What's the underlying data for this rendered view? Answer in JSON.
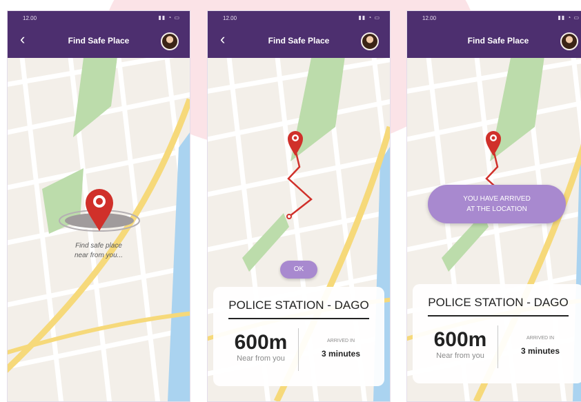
{
  "screens": [
    {
      "status_time": "12.00",
      "title": "Find Safe Place",
      "back_label": "‹",
      "hint_line1": "Find safe place",
      "hint_line2": "near from you..."
    },
    {
      "status_time": "12.00",
      "title": "Find Safe Place",
      "back_label": "‹",
      "ok_label": "OK",
      "place_name": "POLICE STATION - DAGO",
      "distance": "600m",
      "distance_sub": "Near from you",
      "arrive_label": "ARRIVED IN",
      "arrive_value": "3 minutes"
    },
    {
      "status_time": "12.00",
      "title": "Find Safe Place",
      "banner_line1": "YOU HAVE ARRIVED",
      "banner_line2": "AT THE LOCATION",
      "place_name": "POLICE STATION - DAGO",
      "distance": "600m",
      "distance_sub": "Near from you",
      "arrive_label": "ARRIVED IN",
      "arrive_value": "3 minutes"
    }
  ],
  "icons": {
    "status": "signal-wifi-battery-icons",
    "pin": "location-pin-icon",
    "avatar": "user-avatar"
  },
  "colors": {
    "appbar": "#4d2f6f",
    "accent": "#a889cf",
    "route": "#d0302a",
    "park": "#bcdcab",
    "water": "#aad3f0",
    "major_road": "#f6d97a",
    "map_bg": "#f3efe9"
  }
}
